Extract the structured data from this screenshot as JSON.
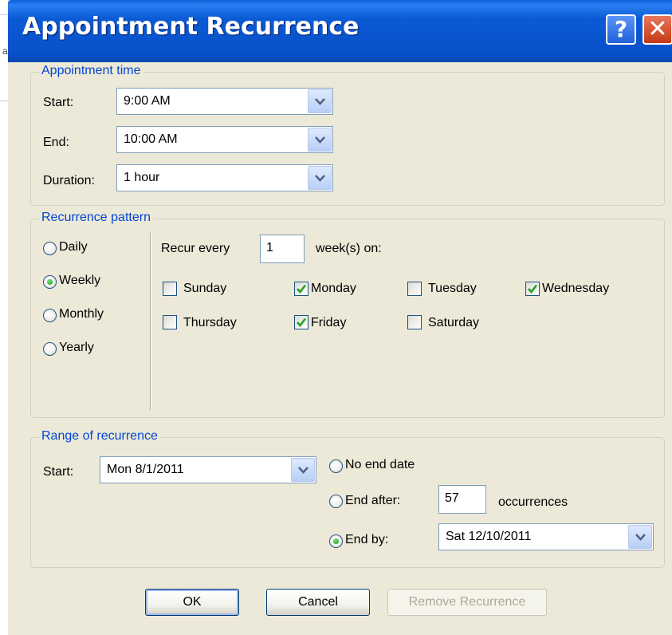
{
  "window": {
    "title": "Appointment Recurrence",
    "help_label": "?",
    "close_label": "✕",
    "background_fragment": "a"
  },
  "appointment_time": {
    "legend": "Appointment time",
    "start_label": "Start:",
    "start_value": "9:00 AM",
    "end_label": "End:",
    "end_value": "10:00 AM",
    "duration_label": "Duration:",
    "duration_value": "1 hour"
  },
  "recurrence_pattern": {
    "legend": "Recurrence pattern",
    "options": [
      {
        "label": "Daily",
        "selected": false
      },
      {
        "label": "Weekly",
        "selected": true
      },
      {
        "label": "Monthly",
        "selected": false
      },
      {
        "label": "Yearly",
        "selected": false
      }
    ],
    "recur_every_label": "Recur every",
    "recur_every_value": "1",
    "weeks_on_label": "week(s) on:",
    "days": [
      {
        "label": "Sunday",
        "checked": false
      },
      {
        "label": "Monday",
        "checked": true
      },
      {
        "label": "Tuesday",
        "checked": false
      },
      {
        "label": "Wednesday",
        "checked": true
      },
      {
        "label": "Thursday",
        "checked": false
      },
      {
        "label": "Friday",
        "checked": true
      },
      {
        "label": "Saturday",
        "checked": false
      }
    ]
  },
  "range": {
    "legend": "Range of recurrence",
    "start_label": "Start:",
    "start_value": "Mon 8/1/2011",
    "no_end_label": "No end date",
    "no_end_selected": false,
    "end_after_label": "End after:",
    "end_after_selected": false,
    "end_after_value": "57",
    "occurrences_label": "occurrences",
    "end_by_label": "End by:",
    "end_by_selected": true,
    "end_by_value": "Sat 12/10/2011"
  },
  "buttons": {
    "ok": "OK",
    "cancel": "Cancel",
    "remove": "Remove Recurrence"
  },
  "colors": {
    "titlebar": "#0a5fd8",
    "legend_text": "#0046d5",
    "dialog_bg": "#ece9d8",
    "checkmark": "#21a121"
  }
}
